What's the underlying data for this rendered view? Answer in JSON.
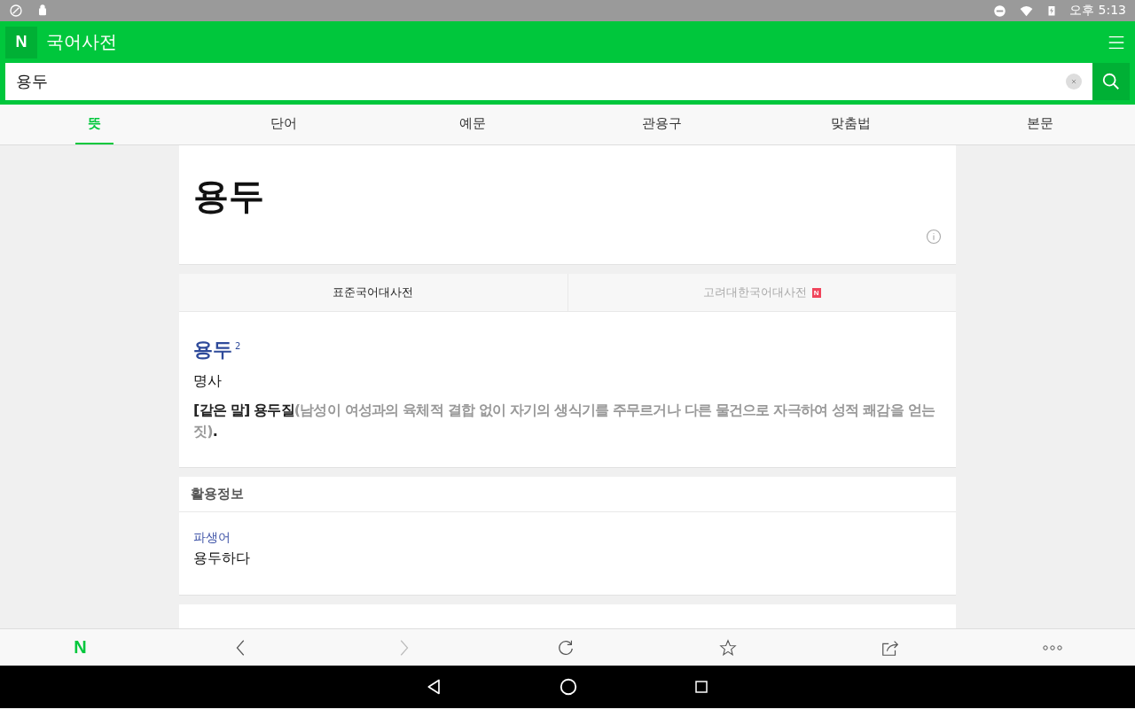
{
  "status_bar": {
    "time": "오후 5:13"
  },
  "app_bar": {
    "logo": "N",
    "title": "국어사전"
  },
  "search": {
    "value": "용두"
  },
  "tabs": [
    {
      "label": "뜻",
      "selected": true
    },
    {
      "label": "단어",
      "selected": false
    },
    {
      "label": "예문",
      "selected": false
    },
    {
      "label": "관용구",
      "selected": false
    },
    {
      "label": "맞춤법",
      "selected": false
    },
    {
      "label": "본문",
      "selected": false
    }
  ],
  "headword": "용두",
  "dictionaries": [
    {
      "label": "표준국어대사전",
      "selected": true
    },
    {
      "label": "고려대한국어대사전",
      "selected": false,
      "badge": "N"
    }
  ],
  "entry": {
    "word": "용두$^{2}$",
    "part_of_speech": "명사",
    "definition": "**[같은 말] 용두질**(남성이 여성과의 육체적 결합 없이 자기의 생식기를 주무르거나 다른 물건으로 자극하여 성적 쾌감을 얻는 짓)**.**"
  },
  "usage_info": {
    "title": "활용정보",
    "label": "파생어",
    "value": "용두하다"
  },
  "toolbar": {
    "logo": "N"
  }
}
